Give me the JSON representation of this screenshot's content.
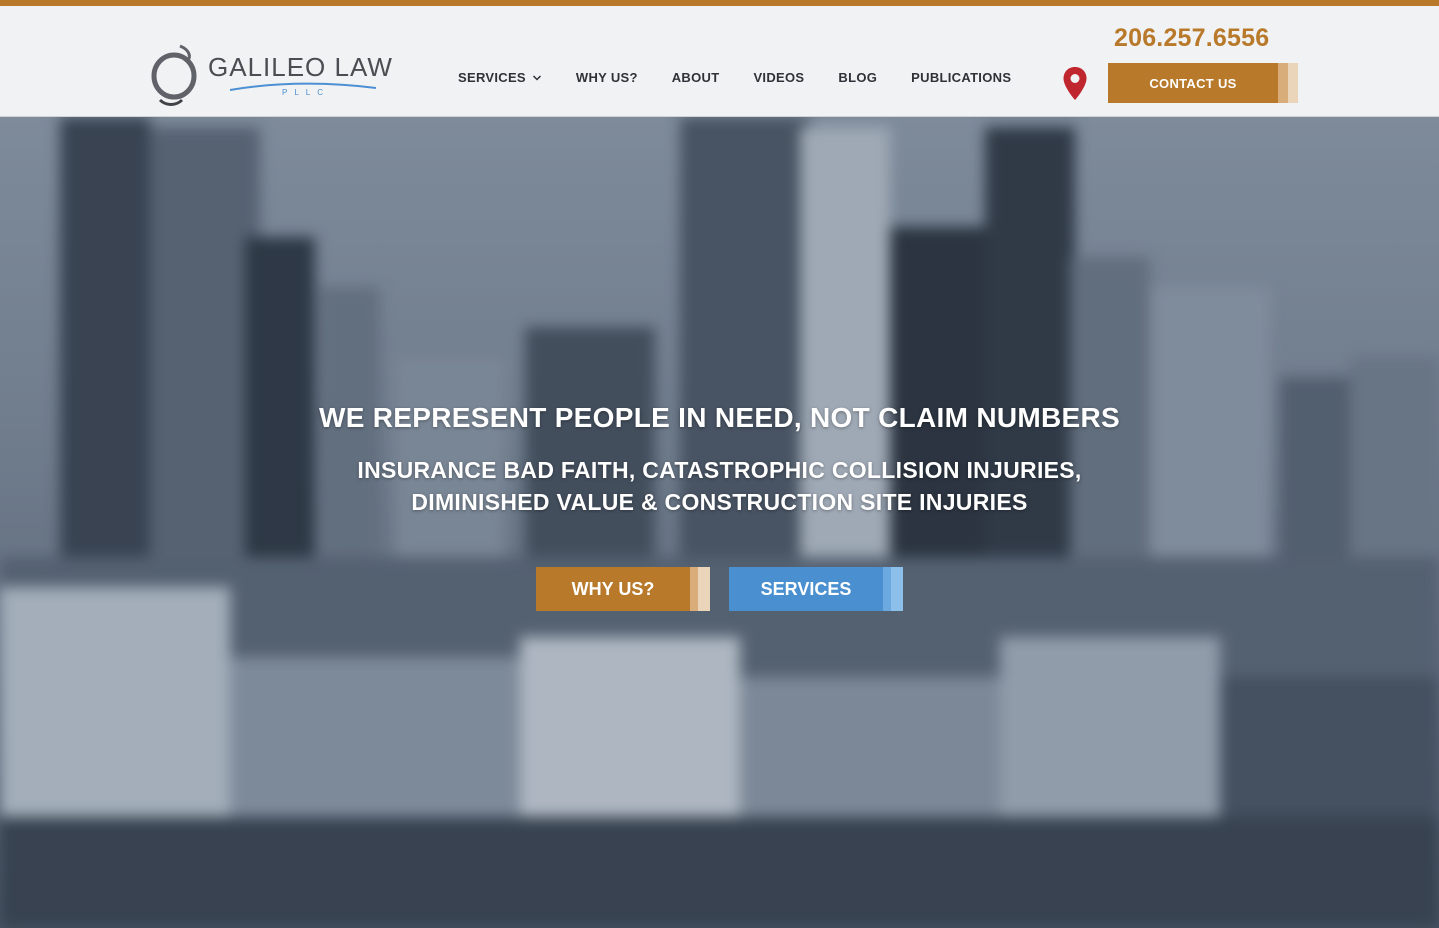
{
  "brand": {
    "name": "GALILEO LAW",
    "sub": "PLLC",
    "logo_icon": "galileo-orbit-logo"
  },
  "header": {
    "nav": [
      {
        "label": "SERVICES",
        "has_dropdown": true
      },
      {
        "label": "WHY US?"
      },
      {
        "label": "ABOUT"
      },
      {
        "label": "VIDEOS"
      },
      {
        "label": "BLOG"
      },
      {
        "label": "PUBLICATIONS"
      }
    ],
    "phone": "206.257.6556",
    "location_icon": "map-pin-icon",
    "contact_label": "CONTACT US"
  },
  "hero": {
    "headline": "WE REPRESENT PEOPLE IN NEED, NOT CLAIM NUMBERS",
    "subline_1": "INSURANCE BAD FAITH, CATASTROPHIC COLLISION INJURIES,",
    "subline_2": "DIMINISHED VALUE & CONSTRUCTION SITE INJURIES",
    "primary_button": "WHY US?",
    "secondary_button": "SERVICES",
    "background": "blurred-city-skyline"
  },
  "colors": {
    "accent_gold": "#b8792a",
    "accent_blue": "#4a8fcf",
    "header_bg": "#f1f2f4",
    "nav_text": "#2f3237",
    "pin_red": "#c0262d"
  }
}
